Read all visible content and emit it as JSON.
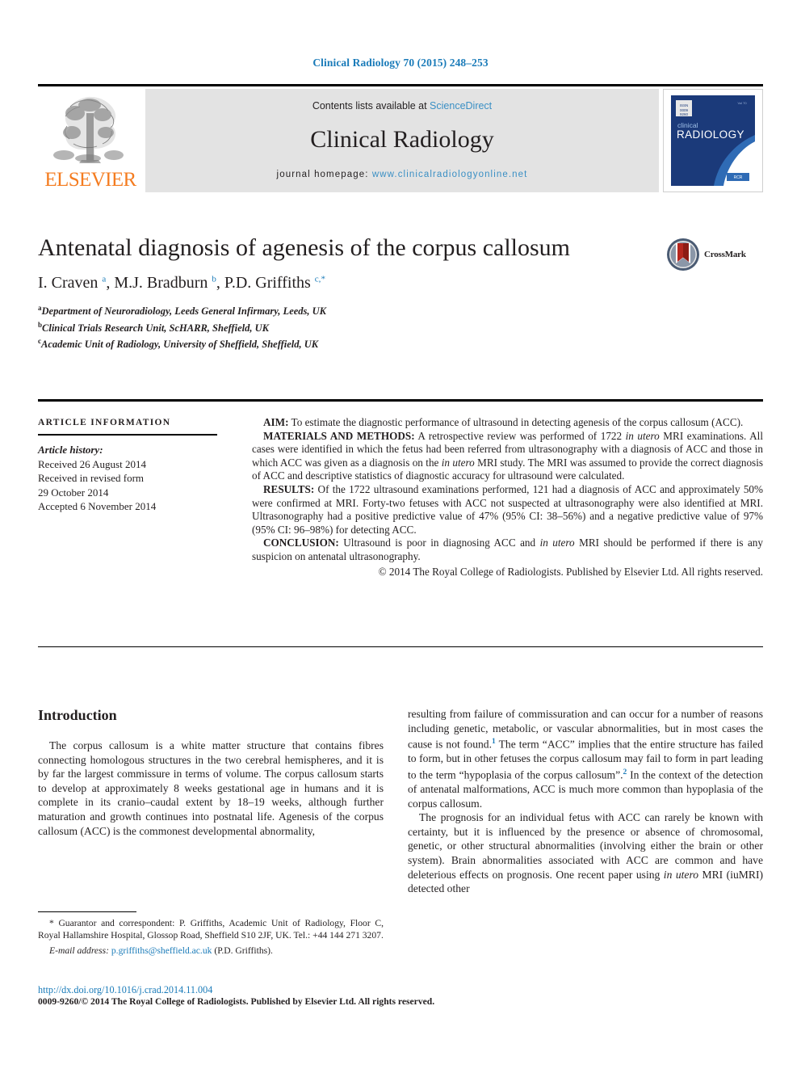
{
  "running_head": "Clinical Radiology 70 (2015) 248–253",
  "masthead": {
    "publisher_name": "ELSEVIER",
    "contents_prefix": "Contents lists available at ",
    "contents_link": "ScienceDirect",
    "journal_name": "Clinical Radiology",
    "homepage_prefix": "journal homepage: ",
    "homepage_url": "www.clinicalradiologyonline.net",
    "cover_title_small": "clinical",
    "cover_title_large": "RADIOLOGY",
    "accent_blue": "#3a8fc4",
    "elsevier_orange": "#F47C20",
    "banner_gray": "#e3e3e3"
  },
  "title_block": {
    "title": "Antenatal diagnosis of agenesis of the corpus callosum",
    "authors_html": "I. Craven <sup>a</sup>, M.J. Bradburn <sup>b</sup>, P.D. Griffiths <sup>c,</sup><sup>*</sup>",
    "affiliations": [
      {
        "marker": "a",
        "text": "Department of Neuroradiology, Leeds General Infirmary, Leeds, UK"
      },
      {
        "marker": "b",
        "text": "Clinical Trials Research Unit, ScHARR, Sheffield, UK"
      },
      {
        "marker": "c",
        "text": "Academic Unit of Radiology, University of Sheffield, Sheffield, UK"
      }
    ],
    "crossmark_label": "CrossMark"
  },
  "article_info": {
    "heading": "ARTICLE INFORMATION",
    "history_label": "Article history:",
    "received": "Received 26 August 2014",
    "revised_label": "Received in revised form",
    "revised_date": "29 October 2014",
    "accepted": "Accepted 6 November 2014"
  },
  "abstract": {
    "aim_label": "AIM:",
    "aim_text": " To estimate the diagnostic performance of ultrasound in detecting agenesis of the corpus callosum (ACC).",
    "materials_label": "MATERIALS AND METHODS:",
    "materials_text_1": " A retrospective review was performed of 1722 ",
    "materials_italic_1": "in utero",
    "materials_text_2": " MRI examinations. All cases were identified in which the fetus had been referred from ultrasonography with a diagnosis of ACC and those in which ACC was given as a diagnosis on the ",
    "materials_italic_2": "in utero",
    "materials_text_3": " MRI study. The MRI was assumed to provide the correct diagnosis of ACC and descriptive statistics of diagnostic accuracy for ultrasound were calculated.",
    "results_label": "RESULTS:",
    "results_text": " Of the 1722 ultrasound examinations performed, 121 had a diagnosis of ACC and approximately 50% were confirmed at MRI. Forty-two fetuses with ACC not suspected at ultrasonography were also identified at MRI. Ultrasonography had a positive predictive value of 47% (95% CI: 38–56%) and a negative predictive value of 97% (95% CI: 96–98%) for detecting ACC.",
    "conclusion_label": "CONCLUSION:",
    "conclusion_text_1": " Ultrasound is poor in diagnosing ACC and ",
    "conclusion_italic": "in utero",
    "conclusion_text_2": " MRI should be performed if there is any suspicion on antenatal ultrasonography.",
    "copyright": "© 2014 The Royal College of Radiologists. Published by Elsevier Ltd. All rights reserved."
  },
  "body": {
    "intro_heading": "Introduction",
    "left_para_1_a": "The corpus callosum is a white matter structure that contains fibres connecting homologous structures in the two cerebral hemispheres, and it is by far the largest commissure in terms of volume. The corpus callosum starts to develop at approximately 8 weeks gestational age in humans and it is complete in its cranio–caudal extent by 18–19 weeks, although further maturation and growth continues into postnatal life. Agenesis of the corpus callosum (ACC) is the commonest developmental abnormality,",
    "right_para_1_a": "resulting from failure of commissuration and can occur for a number of reasons including genetic, metabolic, or vascular abnormalities, but in most cases the cause is not found.",
    "right_para_1_ref1": "1",
    "right_para_1_b": " The term “ACC” implies that the entire structure has failed to form, but in other fetuses the corpus callosum may fail to form in part leading to the term “hypoplasia of the corpus callosum”.",
    "right_para_1_ref2": "2",
    "right_para_1_c": " In the context of the detection of antenatal malformations, ACC is much more common than hypoplasia of the corpus callosum.",
    "right_para_2_a": "The prognosis for an individual fetus with ACC can rarely be known with certainty, but it is influenced by the presence or absence of chromosomal, genetic, or other structural abnormalities (involving either the brain or other system). Brain abnormalities associated with ACC are common and have deleterious effects on prognosis. One recent paper using ",
    "right_para_2_italic": "in utero",
    "right_para_2_b": " MRI (iuMRI) detected other"
  },
  "footnotes": {
    "corresponding": "* Guarantor and correspondent: P. Griffiths, Academic Unit of Radiology, Floor C, Royal Hallamshire Hospital, Glossop Road, Sheffield S10 2JF, UK. Tel.: +44 144 271 3207.",
    "email_label": "E-mail address:",
    "email": "p.griffiths@sheffield.ac.uk",
    "email_suffix": " (P.D. Griffiths).",
    "doi": "http://dx.doi.org/10.1016/j.crad.2014.11.004",
    "issn_line": "0009-9260/© 2014 The Royal College of Radiologists. Published by Elsevier Ltd. All rights reserved."
  }
}
